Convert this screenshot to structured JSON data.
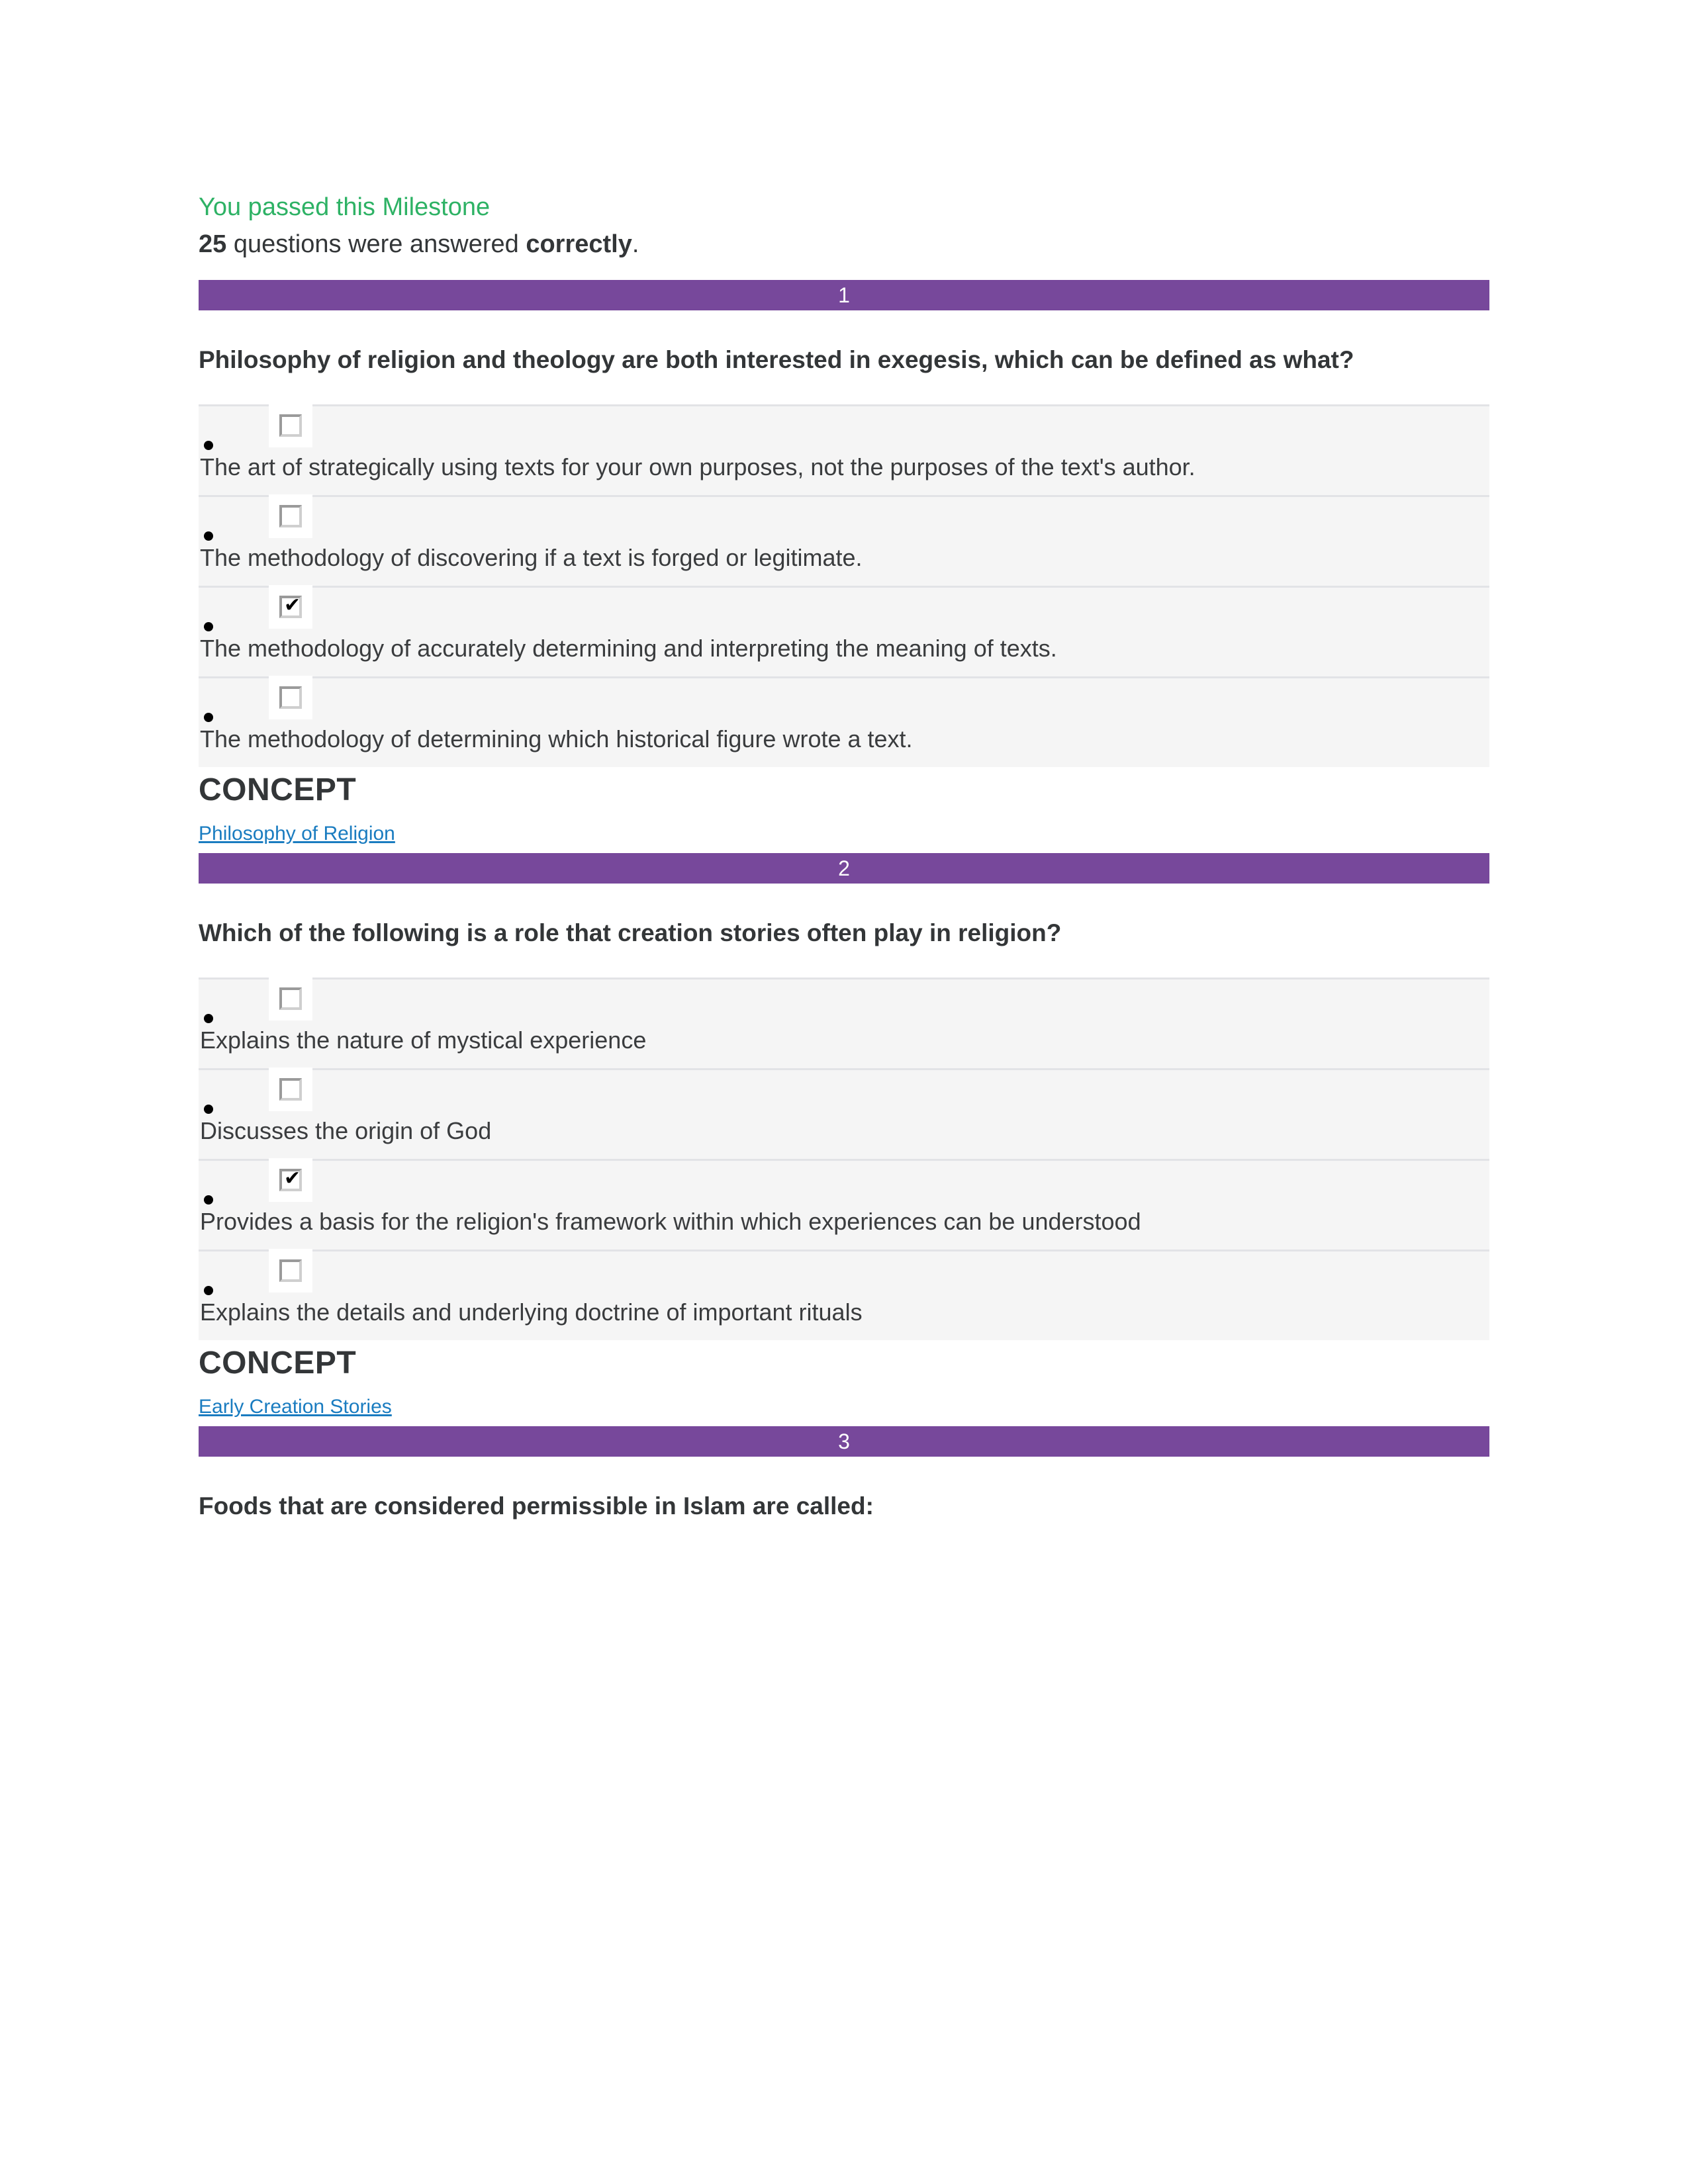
{
  "header": {
    "pass_message": "You passed this Milestone",
    "count": "25",
    "summary_mid": " questions were answered ",
    "summary_bold": "correctly",
    "summary_end": "."
  },
  "concept_label": "CONCEPT",
  "questions": [
    {
      "number": "1",
      "prompt": "Philosophy of religion and theology are both interested in exegesis, which can be defined as what?",
      "options": [
        {
          "text": "The art of strategically using texts for your own purposes, not the purposes of the text's author.",
          "checked": false
        },
        {
          "text": "The methodology of discovering if a text is forged or legitimate.",
          "checked": false
        },
        {
          "text": "The methodology of accurately determining and interpreting the meaning of texts.",
          "checked": true
        },
        {
          "text": "The methodology of determining which historical figure wrote a text.",
          "checked": false
        }
      ],
      "concept_link": "Philosophy of Religion"
    },
    {
      "number": "2",
      "prompt": "Which of the following is a role that creation stories often play in religion?",
      "options": [
        {
          "text": "Explains the nature of mystical experience",
          "checked": false
        },
        {
          "text": "Discusses the origin of God",
          "checked": false
        },
        {
          "text": "Provides a basis for the religion's framework within which experiences can be understood",
          "checked": true
        },
        {
          "text": "Explains the details and underlying doctrine of important rituals",
          "checked": false
        }
      ],
      "concept_link": "Early Creation Stories"
    },
    {
      "number": "3",
      "prompt": "Foods that are considered permissible in Islam are called:",
      "options": [],
      "concept_link": null
    }
  ],
  "colors": {
    "bar_purple": "#77489B",
    "pass_green": "#2EB265",
    "link_blue": "#1A7CC0",
    "row_gray": "#F5F5F5",
    "text_dark": "#333638"
  },
  "icons": {
    "checkbox_checked": "✔",
    "bullet": "•"
  }
}
